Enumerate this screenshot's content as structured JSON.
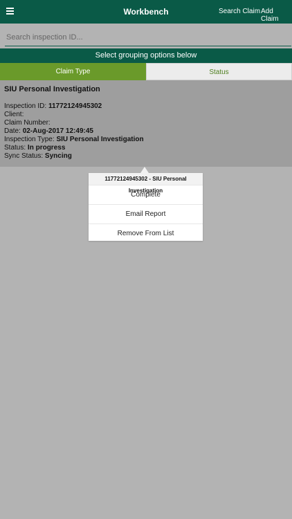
{
  "header": {
    "title": "Workbench",
    "search_claim": "Search Claim",
    "add_claim": "Add Claim"
  },
  "search": {
    "placeholder": "Search inspection ID..."
  },
  "grouping": {
    "banner": "Select grouping options below",
    "tabs": [
      {
        "label": "Claim Type",
        "selected": true
      },
      {
        "label": "Status",
        "selected": false
      }
    ]
  },
  "card": {
    "title": "SIU Personal Investigation",
    "fields": [
      {
        "label": "Inspection ID:",
        "value": "11772124945302"
      },
      {
        "label": "Client:",
        "value": ""
      },
      {
        "label": "Claim Number:",
        "value": ""
      },
      {
        "label": "Date:",
        "value": "02-Aug-2017 12:49:45"
      },
      {
        "label": "Inspection Type:",
        "value": "SIU Personal Investigation"
      },
      {
        "label": "Status:",
        "value": "In progress"
      },
      {
        "label": "Sync Status:",
        "value": "Syncing"
      }
    ]
  },
  "popover": {
    "header": "11772124945302 - SIU Personal Investigation",
    "items": [
      "Complete",
      "Email Report",
      "Remove From List"
    ]
  },
  "colors": {
    "header_bg": "#0a5a47",
    "tab_active": "#6a9a2a",
    "card_bg": "#9e9e9e",
    "background": "#b3b3b3"
  }
}
